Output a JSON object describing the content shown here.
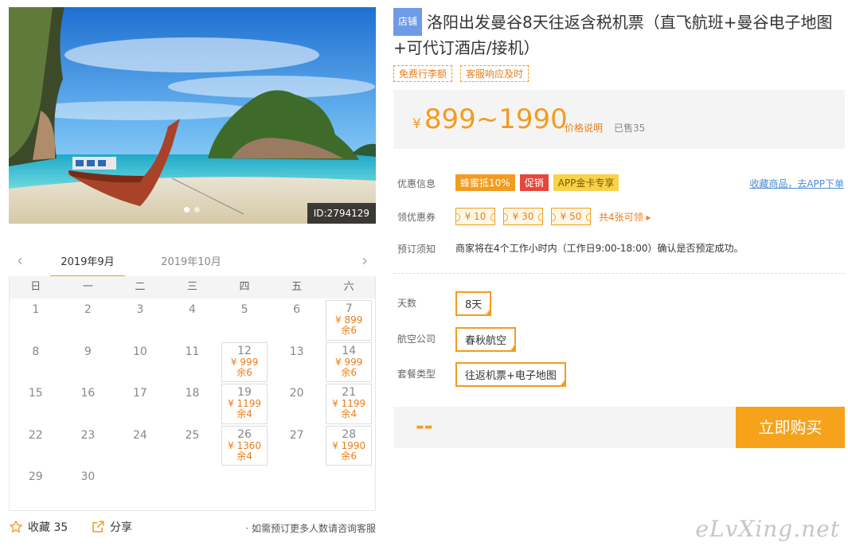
{
  "hero": {
    "id_label": "ID:2794129"
  },
  "calendar": {
    "tabs": [
      "2019年9月",
      "2019年10月"
    ],
    "weekdays": [
      "日",
      "一",
      "二",
      "三",
      "四",
      "五",
      "六"
    ],
    "days": [
      {
        "d": "1"
      },
      {
        "d": "2"
      },
      {
        "d": "3"
      },
      {
        "d": "4"
      },
      {
        "d": "5"
      },
      {
        "d": "6"
      },
      {
        "d": "7",
        "price": "¥ 899",
        "stock": "余6"
      },
      {
        "d": "8"
      },
      {
        "d": "9"
      },
      {
        "d": "10"
      },
      {
        "d": "11"
      },
      {
        "d": "12",
        "price": "¥ 999",
        "stock": "余6"
      },
      {
        "d": "13"
      },
      {
        "d": "14",
        "price": "¥ 999",
        "stock": "余6"
      },
      {
        "d": "15"
      },
      {
        "d": "16"
      },
      {
        "d": "17"
      },
      {
        "d": "18"
      },
      {
        "d": "19",
        "price": "¥ 1199",
        "stock": "余4"
      },
      {
        "d": "20"
      },
      {
        "d": "21",
        "price": "¥ 1199",
        "stock": "余4"
      },
      {
        "d": "22"
      },
      {
        "d": "23"
      },
      {
        "d": "24"
      },
      {
        "d": "25"
      },
      {
        "d": "26",
        "price": "¥ 1360",
        "stock": "余4"
      },
      {
        "d": "27"
      },
      {
        "d": "28",
        "price": "¥ 1990",
        "stock": "余6"
      },
      {
        "d": "29"
      },
      {
        "d": "30"
      }
    ]
  },
  "bottom": {
    "fav_label": "收藏 35",
    "share_label": "分享",
    "note": "· 如需预订更多人数请咨询客服"
  },
  "product": {
    "badge": "店铺",
    "title": "洛阳出发曼谷8天往返含税机票（直飞航班+曼谷电子地图+可代订酒店/接机）",
    "tags": [
      "免费行李额",
      "客服响应及时"
    ]
  },
  "price": {
    "currency": "¥",
    "range": "899~1990",
    "note": "价格说明",
    "sold": "已售35"
  },
  "promo": {
    "label": "优惠信息",
    "items": [
      "蜂蜜抵10%",
      "促销",
      "APP金卡专享"
    ],
    "app_link": "收藏商品，去APP下单"
  },
  "coupons": {
    "label": "领优惠券",
    "items": [
      "¥ 10",
      "¥ 30",
      "¥ 50"
    ],
    "more": "共4张可领 ▸"
  },
  "notice": {
    "label": "预订须知",
    "text": "商家将在4个工作小时内（工作日9:00-18:00）确认是否预定成功。"
  },
  "options": {
    "days_label": "天数",
    "days_value": "8天",
    "airline_label": "航空公司",
    "airline_value": "春秋航空",
    "package_label": "套餐类型",
    "package_value": "往返机票+电子地图"
  },
  "buy": {
    "total": "--",
    "button": "立即购买"
  },
  "watermark": "eLvXing.net"
}
